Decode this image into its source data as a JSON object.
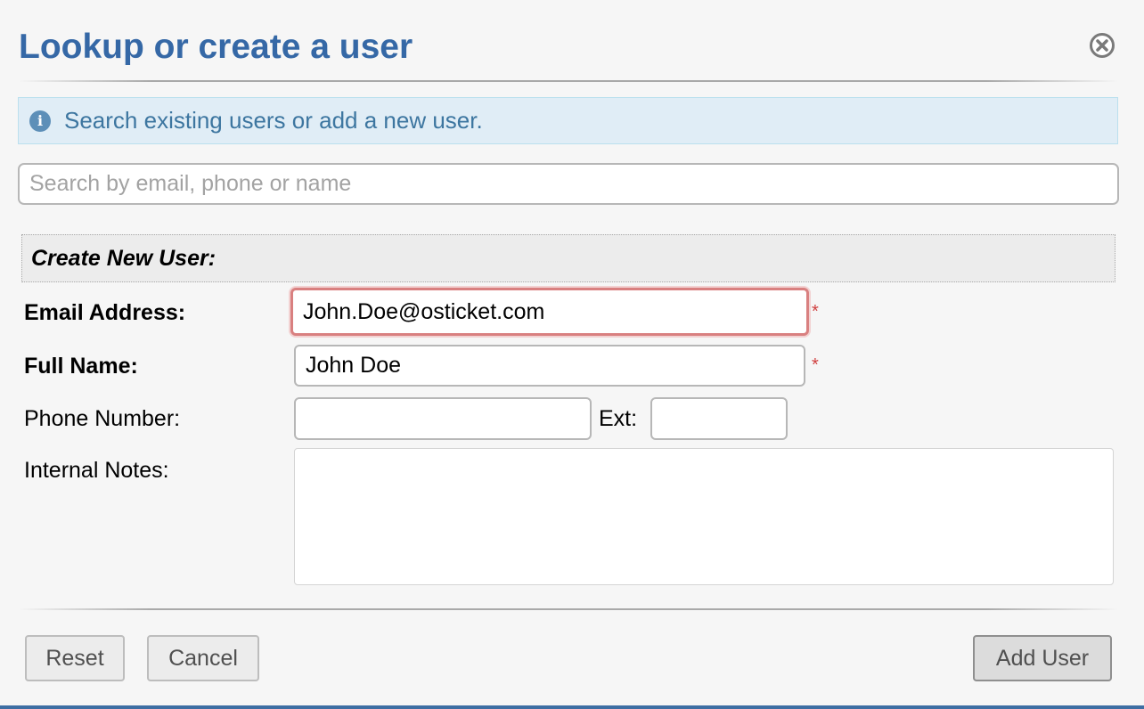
{
  "dialog": {
    "title": "Lookup or create a user"
  },
  "info": {
    "message": "Search existing users or add a new user."
  },
  "search": {
    "placeholder": "Search by email, phone or name",
    "value": ""
  },
  "form": {
    "section_title": "Create New User:",
    "email": {
      "label": "Email Address:",
      "value": "John.Doe@osticket.com",
      "required_mark": "*"
    },
    "full_name": {
      "label": "Full Name:",
      "value": "John Doe",
      "required_mark": "*"
    },
    "phone": {
      "label": "Phone Number:",
      "value": "",
      "ext_label": "Ext:",
      "ext_value": ""
    },
    "notes": {
      "label": "Internal Notes:",
      "value": ""
    }
  },
  "buttons": {
    "reset": "Reset",
    "cancel": "Cancel",
    "add_user": "Add User"
  },
  "colors": {
    "title": "#3568a6",
    "info_background": "#e0edf6",
    "info_text": "#3d76a0",
    "error_border": "#d98080",
    "required": "#d04040"
  },
  "icons": {
    "close": "close-circle-icon",
    "info": "info-circle-icon"
  }
}
